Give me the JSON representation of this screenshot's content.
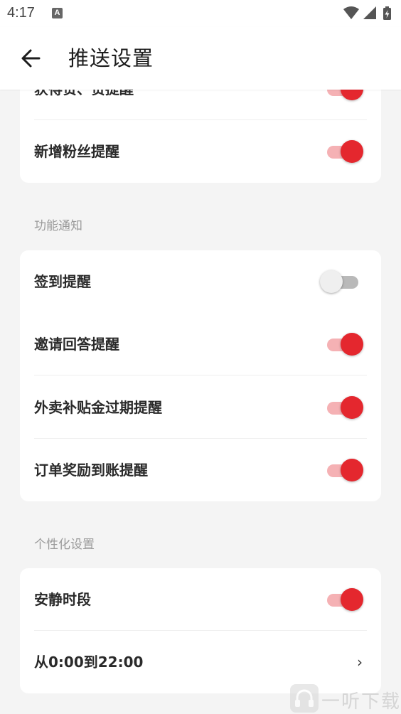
{
  "status_bar": {
    "time": "4:17",
    "notification_badge": "A",
    "icons": [
      "wifi-icon",
      "signal-icon",
      "battery-charging-icon"
    ]
  },
  "header": {
    "back_icon": "arrow-left-icon",
    "title": "推送设置"
  },
  "top_card": {
    "rows": [
      {
        "label": "获得赞、赞提醒",
        "enabled": true
      },
      {
        "label": "新增粉丝提醒",
        "enabled": true
      }
    ]
  },
  "sections": [
    {
      "title": "功能通知",
      "rows": [
        {
          "label": "签到提醒",
          "enabled": false
        },
        {
          "label": "邀请回答提醒",
          "enabled": true
        },
        {
          "label": "外卖补贴金过期提醒",
          "enabled": true
        },
        {
          "label": "订单奖励到账提醒",
          "enabled": true
        }
      ]
    },
    {
      "title": "个性化设置",
      "rows": [
        {
          "label": "安静时段",
          "enabled": true
        },
        {
          "label": "从0:00到22:00",
          "chevron": "›"
        }
      ]
    }
  ],
  "watermark": {
    "text": "一听下载",
    "icon": "headphones-logo-icon"
  },
  "colors": {
    "accent": "#e4272e",
    "accent_track": "#f5b1b4",
    "background": "#f4f4f4",
    "card": "#ffffff",
    "section_label": "#9a9a9a"
  }
}
